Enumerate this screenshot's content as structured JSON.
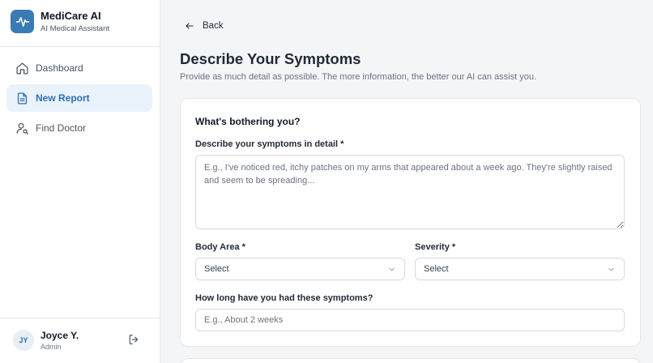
{
  "brand": {
    "name": "MediCare AI",
    "subtitle": "AI Medical Assistant",
    "logo_icon": "heartbeat-icon",
    "accent": "#3b7bb5"
  },
  "nav": {
    "items": [
      {
        "label": "Dashboard",
        "icon": "home-icon",
        "active": false
      },
      {
        "label": "New Report",
        "icon": "document-icon",
        "active": true
      },
      {
        "label": "Find Doctor",
        "icon": "user-search-icon",
        "active": false
      }
    ]
  },
  "user": {
    "initials": "JY",
    "name": "Joyce Y.",
    "role": "Admin",
    "logout_icon": "logout-icon"
  },
  "page": {
    "back_label": "Back",
    "title": "Describe Your Symptoms",
    "subtitle": "Provide as much detail as possible. The more information, the better our AI can assist you."
  },
  "form": {
    "section_title": "What's bothering you?",
    "symptoms_label": "Describe your symptoms in detail *",
    "symptoms_placeholder": "E.g., I've noticed red, itchy patches on my arms that appeared about a week ago. They're slightly raised and seem to be spreading...",
    "body_area_label": "Body Area *",
    "body_area_value": "Select",
    "severity_label": "Severity *",
    "severity_value": "Select",
    "duration_label": "How long have you had these symptoms?",
    "duration_placeholder": "E.g., About 2 weeks"
  }
}
